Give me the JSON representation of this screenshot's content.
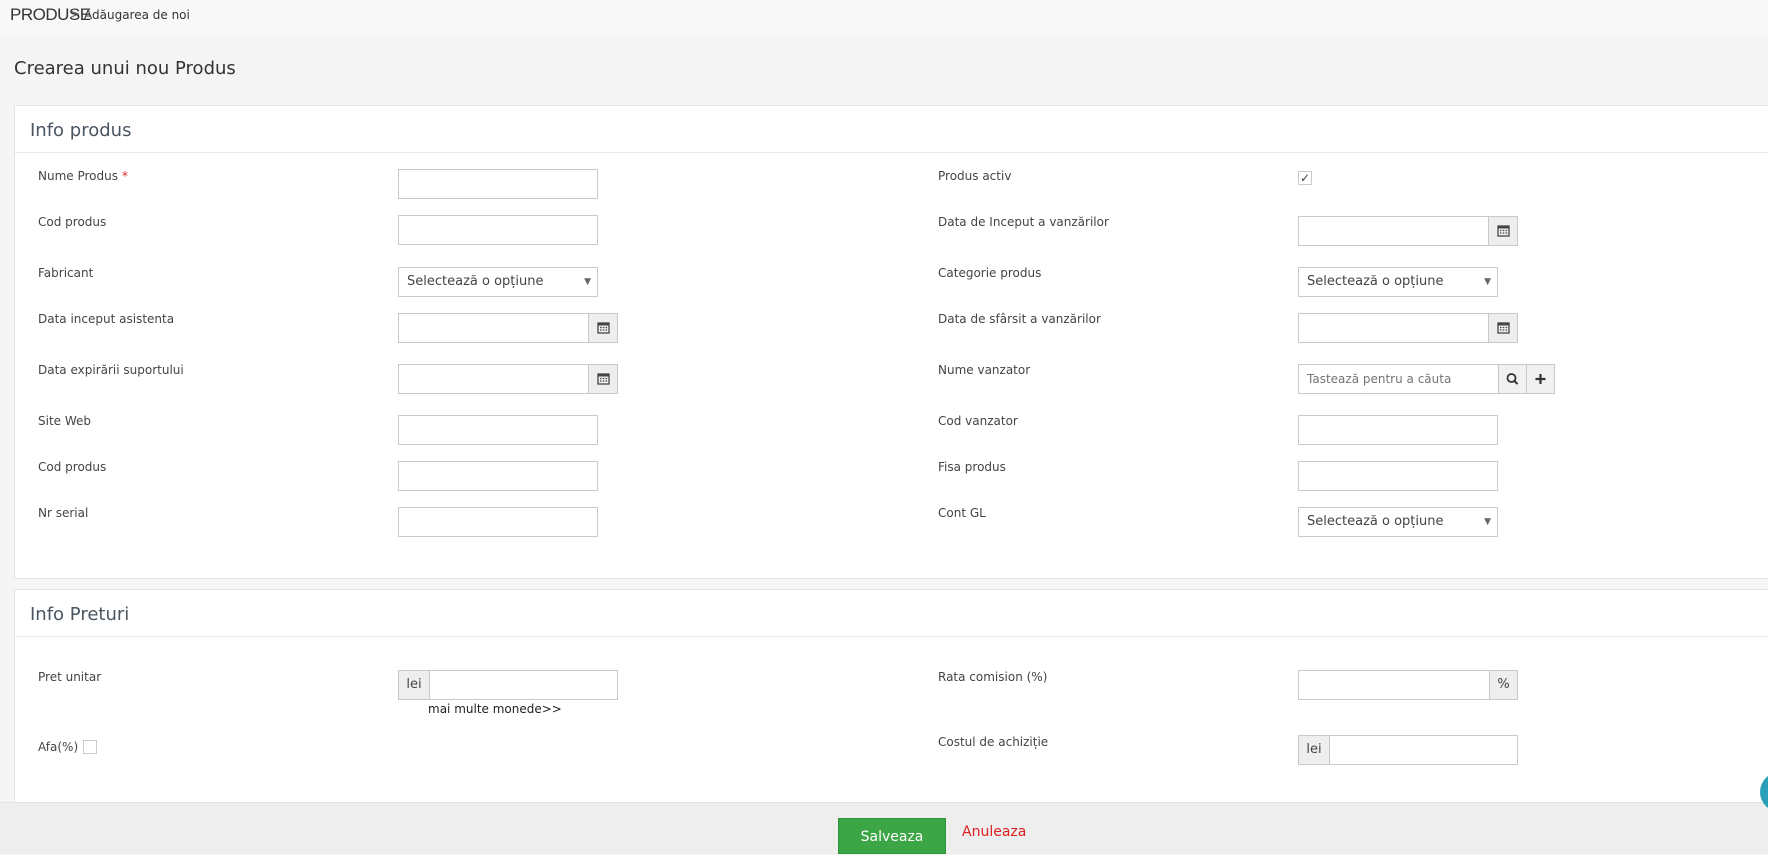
{
  "breadcrumb": {
    "root": "PRODUSE",
    "separator": ">",
    "current": "Adăugarea de noi"
  },
  "page": {
    "title": "Crearea unui nou Produs"
  },
  "info_produs": {
    "title": "Info produs",
    "fields": {
      "nume_produs": {
        "label": "Nume Produs",
        "required_mark": "*",
        "value": ""
      },
      "cod_produs": {
        "label": "Cod produs",
        "value": ""
      },
      "fabricant": {
        "label": "Fabricant",
        "value": "Selectează o opțiune"
      },
      "data_inceput_asistenta": {
        "label": "Data inceput asistenta",
        "value": ""
      },
      "data_expirarii_suportului": {
        "label": "Data expirării suportului",
        "value": ""
      },
      "site_web": {
        "label": "Site Web",
        "value": ""
      },
      "cod_produs_2": {
        "label": "Cod produs",
        "value": ""
      },
      "nr_serial": {
        "label": "Nr serial",
        "value": ""
      },
      "produs_activ": {
        "label": "Produs activ",
        "checked": true,
        "check_glyph": "✓"
      },
      "data_inceput_vanzarilor": {
        "label": "Data de Inceput a vanzărilor",
        "value": ""
      },
      "categorie_produs": {
        "label": "Categorie produs",
        "value": "Selectează o opțiune"
      },
      "data_sfarsit_vanzarilor": {
        "label": "Data de sfârsit a vanzărilor",
        "value": ""
      },
      "nume_vanzator": {
        "label": "Nume vanzator",
        "placeholder": "Tastează pentru a căuta"
      },
      "cod_vanzator": {
        "label": "Cod vanzator",
        "value": ""
      },
      "fisa_produs": {
        "label": "Fisa produs",
        "value": ""
      },
      "cont_gl": {
        "label": "Cont GL",
        "value": "Selectează o opțiune"
      }
    }
  },
  "info_preturi": {
    "title": "Info Preturi",
    "fields": {
      "pret_unitar": {
        "label": "Pret unitar",
        "currency": "lei",
        "value": ""
      },
      "more_currencies": "mai multe monede>>",
      "afa": {
        "label": "Afa(%)",
        "checked": false
      },
      "rata_comision": {
        "label": "Rata comision (%)",
        "suffix": "%",
        "value": ""
      },
      "costul_achizitie": {
        "label": "Costul de achiziție",
        "currency": "lei",
        "value": ""
      }
    }
  },
  "footer": {
    "save_label": "Salveaza",
    "cancel_label": "Anuleaza"
  },
  "colors": {
    "save_button": "#3ca646",
    "cancel_link": "#e02020",
    "required": "#e02222",
    "chat_bubble": "#2aa0b8"
  },
  "icons": {
    "calendar": "calendar-icon",
    "search": "search-icon",
    "plus": "plus-icon",
    "caret": "caret-down-icon",
    "chat": "chat-icon"
  }
}
